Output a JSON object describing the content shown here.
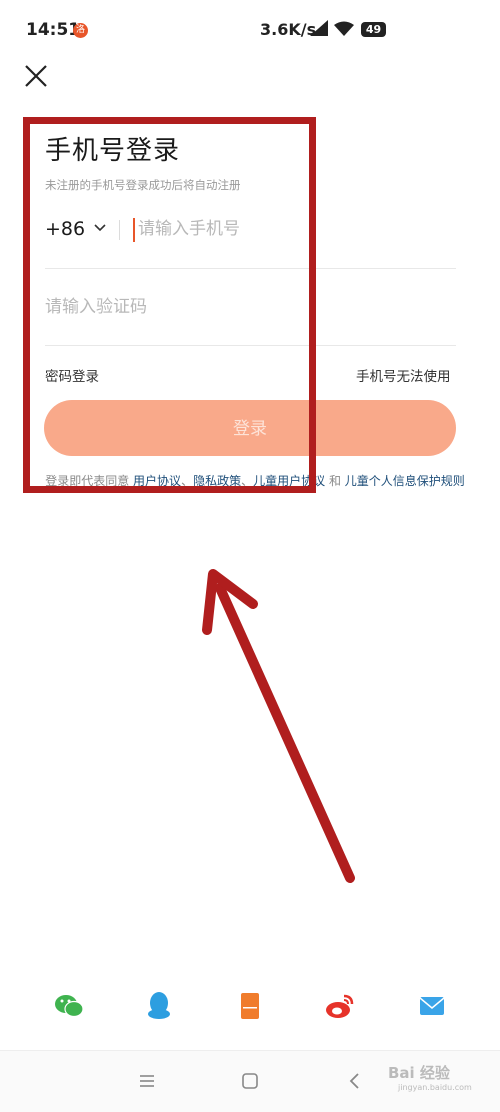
{
  "status": {
    "time": "14:51",
    "notif": "洛",
    "net_speed": "3.6K/s",
    "battery": "49"
  },
  "login": {
    "title": "手机号登录",
    "subtitle": "未注册的手机号登录成功后将自动注册",
    "country_code": "+86",
    "phone_placeholder": "请输入手机号",
    "code_placeholder": "请输入验证码",
    "password_login": "密码登录",
    "phone_unavailable": "手机号无法使用",
    "login_button": "登录"
  },
  "agreement": {
    "prefix": "登录即代表同意 ",
    "user_agreement": "用户协议",
    "sep1": "、",
    "privacy_policy": "隐私政策",
    "sep2": "、",
    "children_agreement": "儿童用户协议",
    "and": " 和 ",
    "children_privacy": "儿童个人信息保护规则"
  },
  "third_party": [
    "wechat-icon",
    "qq-icon",
    "phone-icon",
    "weibo-icon",
    "email-icon"
  ],
  "watermark": {
    "brand": "Bai 经验",
    "url": "jingyan.baidu.com"
  },
  "colors": {
    "accent": "#e8562a",
    "button": "#f9a98a",
    "annotation": "#b01e1e",
    "link": "#1f4f7a"
  }
}
